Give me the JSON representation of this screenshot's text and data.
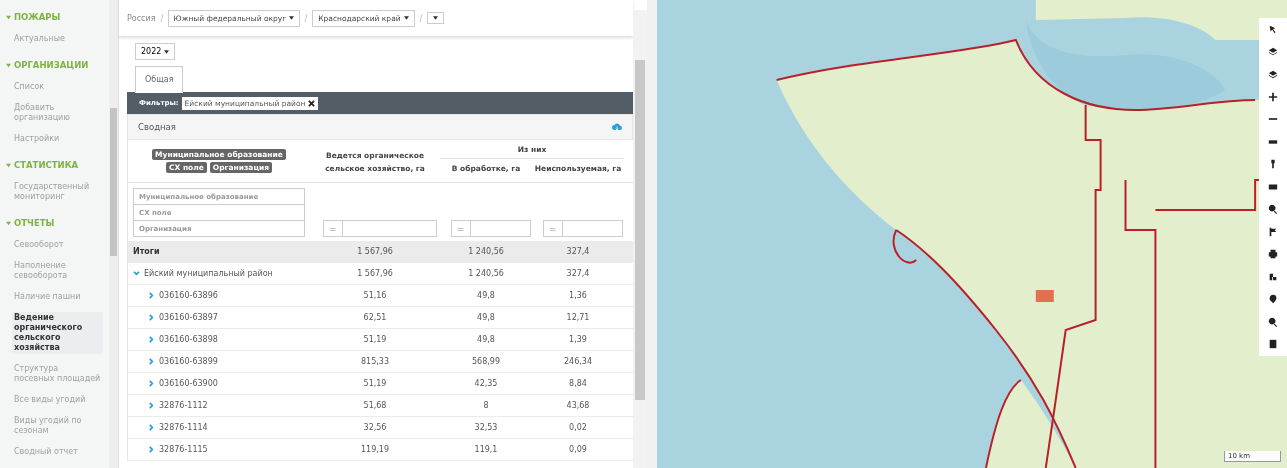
{
  "sidebar": {
    "sections": [
      {
        "title": "ПОЖАРЫ",
        "expanded": true,
        "items": [
          {
            "label": "Актуальные",
            "selected": false
          }
        ]
      },
      {
        "title": "ОРГАНИЗАЦИИ",
        "expanded": true,
        "items": [
          {
            "label": "Список",
            "selected": false
          },
          {
            "label": "Добавить организацию",
            "selected": false
          },
          {
            "label": "Настройки",
            "selected": false
          }
        ]
      },
      {
        "title": "СТАТИСТИКА",
        "expanded": true,
        "items": [
          {
            "label": "Государственный мониторинг",
            "selected": false
          }
        ]
      },
      {
        "title": "ОТЧЕТЫ",
        "expanded": true,
        "items": [
          {
            "label": "Севооборот",
            "selected": false
          },
          {
            "label": "Наполнение севооборота",
            "selected": false
          },
          {
            "label": "Наличие пашни",
            "selected": false
          },
          {
            "label": "Ведение органического сельского хозяйства",
            "selected": true
          },
          {
            "label": "Структура посевных площадей",
            "selected": false
          },
          {
            "label": "Все виды угодий",
            "selected": false
          },
          {
            "label": "Виды угодий по сезонам",
            "selected": false
          },
          {
            "label": "Сводный отчет",
            "selected": false
          }
        ]
      }
    ]
  },
  "breadcrumb": {
    "root": "Россия",
    "dropdowns": [
      "Южный федеральный округ",
      "Краснодарский край"
    ]
  },
  "year": "2022",
  "tabs": [
    {
      "label": "Общая",
      "selected": true
    }
  ],
  "filters": {
    "label": "Фильтры:",
    "chips": [
      "Ейский муниципальный район"
    ]
  },
  "panel": {
    "title": "Сводная"
  },
  "groupings": [
    "Муниципальное образование",
    "СХ поле",
    "Организация"
  ],
  "table": {
    "columns": {
      "organic": "Ведется органическое сельское хозяйство, га",
      "group": "Из них",
      "cultivated": "В обработке, га",
      "unused": "Неиспользуемая, га"
    },
    "row_filters": [
      {
        "placeholder": "Муниципальное образование"
      },
      {
        "placeholder": "СХ поле"
      },
      {
        "placeholder": "Организация"
      }
    ],
    "operator": "=",
    "total": {
      "label": "Итоги",
      "values": [
        "1 567,96",
        "1 240,56",
        "327,4"
      ]
    },
    "groups": [
      {
        "label": "Ейский муниципальный район",
        "expanded": true,
        "values": [
          "1 567,96",
          "1 240,56",
          "327,4"
        ],
        "children": [
          {
            "label": "036160-63896",
            "expanded": false,
            "values": [
              "51,16",
              "49,8",
              "1,36"
            ]
          },
          {
            "label": "036160-63897",
            "expanded": false,
            "values": [
              "62,51",
              "49,8",
              "12,71"
            ]
          },
          {
            "label": "036160-63898",
            "expanded": false,
            "values": [
              "51,19",
              "49,8",
              "1,39"
            ]
          },
          {
            "label": "036160-63899",
            "expanded": false,
            "values": [
              "815,33",
              "568,99",
              "246,34"
            ]
          },
          {
            "label": "036160-63900",
            "expanded": false,
            "values": [
              "51,19",
              "42,35",
              "8,84"
            ]
          },
          {
            "label": "32876-1112",
            "expanded": false,
            "values": [
              "51,68",
              "8",
              "43,68"
            ]
          },
          {
            "label": "32876-1114",
            "expanded": false,
            "values": [
              "32,56",
              "32,53",
              "0,02"
            ]
          },
          {
            "label": "32876-1115",
            "expanded": false,
            "values": [
              "119,19",
              "119,1",
              "0,09"
            ]
          }
        ]
      }
    ]
  },
  "map": {
    "scale": "10 km"
  }
}
